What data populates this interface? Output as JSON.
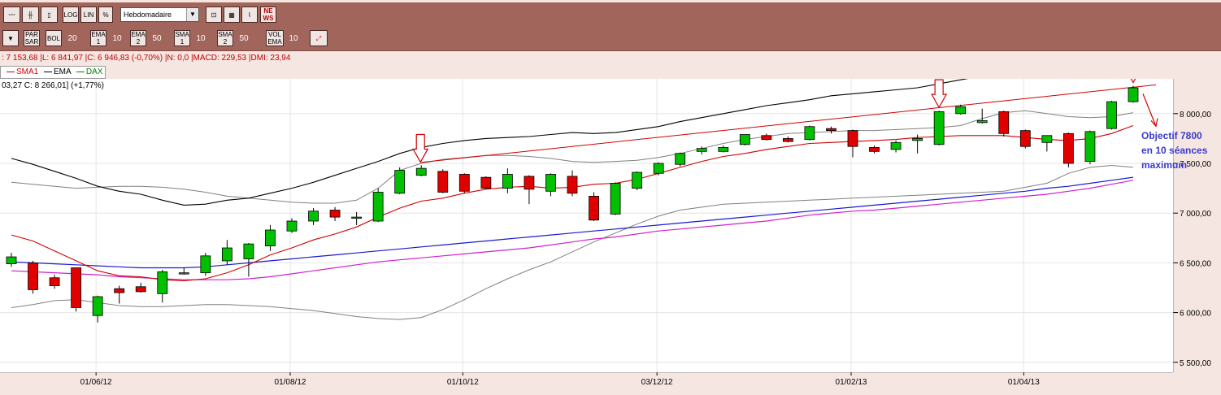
{
  "toolbar1": {
    "buttons": [
      "LOG",
      "LIN",
      "%"
    ],
    "period_select": "Hebdomadaire"
  },
  "toolbar2": {
    "items": [
      {
        "label": "PAR SAR",
        "value": ""
      },
      {
        "label": "BOL",
        "value": "20"
      },
      {
        "label": "EMA 1",
        "value": "10"
      },
      {
        "label": "EMA 2",
        "value": "50"
      },
      {
        "label": "SMA 1",
        "value": "10"
      },
      {
        "label": "SMA 2",
        "value": "50"
      },
      {
        "label": "VOL EMA",
        "value": "10"
      }
    ]
  },
  "status_line": ": 7 153,68 |L: 6 841,97 |C: 6 946,83 (-0,70%) |N: 0,0 |MACD: 229,53 |DMI: 23,94",
  "legend": [
    {
      "name": "SMA1",
      "color": "#d00000"
    },
    {
      "name": "EMA",
      "color": "#000000"
    },
    {
      "name": "DAX",
      "color": "#008000"
    }
  ],
  "price_label": "03,27  C: 8 266,01] (+1,77%)",
  "annotation": {
    "line1": "Objectif 7800",
    "line2": "en 10 séances",
    "line3": "maximum"
  },
  "chart_data": {
    "type": "candlestick",
    "x_tick_labels": [
      "01/06/12",
      "01/08/12",
      "01/10/12",
      "03/12/12",
      "01/02/13",
      "01/04/13"
    ],
    "y_tick_labels": [
      "5 500,00",
      "6 000,00",
      "6 500,00",
      "7 000,00",
      "7 500,00",
      "8 000,00"
    ],
    "ylim": [
      5400,
      8350
    ],
    "grid": true,
    "colors": {
      "up": "#00c000",
      "down": "#e00000",
      "sma1": "#d00000",
      "ema": "#000000",
      "blue": "#1a1ad0",
      "magenta": "#d020d0",
      "bollinger": "#808080"
    },
    "candles": [
      {
        "o": 6490,
        "c": 6560,
        "h": 6600,
        "l": 6460
      },
      {
        "o": 6500,
        "c": 6230,
        "h": 6520,
        "l": 6190
      },
      {
        "o": 6350,
        "c": 6270,
        "h": 6380,
        "l": 6240
      },
      {
        "o": 6450,
        "c": 6050,
        "h": 6450,
        "l": 6010
      },
      {
        "o": 5970,
        "c": 6160,
        "h": 6170,
        "l": 5900
      },
      {
        "o": 6240,
        "c": 6200,
        "h": 6270,
        "l": 6090
      },
      {
        "o": 6260,
        "c": 6210,
        "h": 6300,
        "l": 6200
      },
      {
        "o": 6190,
        "c": 6410,
        "h": 6430,
        "l": 6100
      },
      {
        "o": 6390,
        "c": 6400,
        "h": 6450,
        "l": 6380
      },
      {
        "o": 6400,
        "c": 6570,
        "h": 6600,
        "l": 6370
      },
      {
        "o": 6520,
        "c": 6650,
        "h": 6730,
        "l": 6480
      },
      {
        "o": 6540,
        "c": 6690,
        "h": 6700,
        "l": 6360
      },
      {
        "o": 6670,
        "c": 6830,
        "h": 6880,
        "l": 6620
      },
      {
        "o": 6820,
        "c": 6920,
        "h": 6950,
        "l": 6800
      },
      {
        "o": 6920,
        "c": 7020,
        "h": 7050,
        "l": 6880
      },
      {
        "o": 7030,
        "c": 6960,
        "h": 7060,
        "l": 6920
      },
      {
        "o": 6960,
        "c": 6960,
        "h": 7010,
        "l": 6880
      },
      {
        "o": 6920,
        "c": 7210,
        "h": 7250,
        "l": 6910
      },
      {
        "o": 7200,
        "c": 7430,
        "h": 7460,
        "l": 7190
      },
      {
        "o": 7380,
        "c": 7450,
        "h": 7480,
        "l": 7370
      },
      {
        "o": 7420,
        "c": 7210,
        "h": 7440,
        "l": 7200
      },
      {
        "o": 7390,
        "c": 7220,
        "h": 7400,
        "l": 7200
      },
      {
        "o": 7360,
        "c": 7250,
        "h": 7370,
        "l": 7240
      },
      {
        "o": 7250,
        "c": 7390,
        "h": 7450,
        "l": 7200
      },
      {
        "o": 7370,
        "c": 7240,
        "h": 7380,
        "l": 7090
      },
      {
        "o": 7220,
        "c": 7390,
        "h": 7400,
        "l": 7170
      },
      {
        "o": 7370,
        "c": 7200,
        "h": 7430,
        "l": 7170
      },
      {
        "o": 7170,
        "c": 6930,
        "h": 7210,
        "l": 6920
      },
      {
        "o": 6990,
        "c": 7300,
        "h": 7310,
        "l": 6980
      },
      {
        "o": 7250,
        "c": 7410,
        "h": 7420,
        "l": 7230
      },
      {
        "o": 7400,
        "c": 7500,
        "h": 7510,
        "l": 7380
      },
      {
        "o": 7490,
        "c": 7600,
        "h": 7610,
        "l": 7470
      },
      {
        "o": 7620,
        "c": 7650,
        "h": 7670,
        "l": 7590
      },
      {
        "o": 7620,
        "c": 7660,
        "h": 7680,
        "l": 7610
      },
      {
        "o": 7690,
        "c": 7790,
        "h": 7790,
        "l": 7680
      },
      {
        "o": 7780,
        "c": 7740,
        "h": 7800,
        "l": 7730
      },
      {
        "o": 7750,
        "c": 7720,
        "h": 7770,
        "l": 7710
      },
      {
        "o": 7740,
        "c": 7870,
        "h": 7880,
        "l": 7730
      },
      {
        "o": 7850,
        "c": 7830,
        "h": 7870,
        "l": 7800
      },
      {
        "o": 7830,
        "c": 7670,
        "h": 7840,
        "l": 7560
      },
      {
        "o": 7660,
        "c": 7620,
        "h": 7680,
        "l": 7600
      },
      {
        "o": 7640,
        "c": 7710,
        "h": 7730,
        "l": 7610
      },
      {
        "o": 7730,
        "c": 7750,
        "h": 7790,
        "l": 7600
      },
      {
        "o": 7690,
        "c": 8020,
        "h": 8030,
        "l": 7680
      },
      {
        "o": 8000,
        "c": 8070,
        "h": 8090,
        "l": 7990
      },
      {
        "o": 7910,
        "c": 7930,
        "h": 8050,
        "l": 7900
      },
      {
        "o": 8020,
        "c": 7800,
        "h": 8030,
        "l": 7770
      },
      {
        "o": 7830,
        "c": 7670,
        "h": 7840,
        "l": 7650
      },
      {
        "o": 7710,
        "c": 7780,
        "h": 7780,
        "l": 7620
      },
      {
        "o": 7800,
        "c": 7500,
        "h": 7810,
        "l": 7460
      },
      {
        "o": 7520,
        "c": 7820,
        "h": 7830,
        "l": 7490
      },
      {
        "o": 7850,
        "c": 8120,
        "h": 8130,
        "l": 7840
      },
      {
        "o": 8120,
        "c": 8260,
        "h": 8280,
        "l": 8110
      }
    ],
    "ema": [
      7550,
      7490,
      7420,
      7350,
      7270,
      7220,
      7190,
      7130,
      7080,
      7090,
      7130,
      7150,
      7200,
      7250,
      7310,
      7380,
      7450,
      7520,
      7600,
      7660,
      7700,
      7730,
      7750,
      7760,
      7770,
      7790,
      7810,
      7800,
      7810,
      7840,
      7870,
      7920,
      7960,
      8000,
      8040,
      8080,
      8110,
      8140,
      8180,
      8200,
      8220,
      8240,
      8260,
      8300,
      8340,
      8380,
      8400,
      8420,
      8440,
      8460,
      8480,
      8520,
      8580
    ],
    "sma1": [
      6780,
      6720,
      6620,
      6520,
      6420,
      6370,
      6360,
      6330,
      6320,
      6340,
      6400,
      6480,
      6580,
      6650,
      6730,
      6790,
      6860,
      6960,
      7050,
      7120,
      7150,
      7200,
      7240,
      7260,
      7270,
      7250,
      7260,
      7290,
      7300,
      7340,
      7400,
      7460,
      7520,
      7570,
      7600,
      7640,
      7670,
      7700,
      7710,
      7720,
      7730,
      7740,
      7760,
      7770,
      7780,
      7780,
      7780,
      7760,
      7740,
      7730,
      7750,
      7800,
      7880
    ],
    "blue_ma": [
      6510,
      6500,
      6490,
      6480,
      6470,
      6460,
      6450,
      6450,
      6450,
      6460,
      6480,
      6500,
      6520,
      6540,
      6560,
      6580,
      6600,
      6620,
      6640,
      6660,
      6680,
      6700,
      6720,
      6740,
      6760,
      6780,
      6800,
      6820,
      6840,
      6860,
      6880,
      6900,
      6920,
      6940,
      6960,
      6980,
      7000,
      7020,
      7040,
      7060,
      7080,
      7100,
      7120,
      7140,
      7160,
      7180,
      7200,
      7220,
      7250,
      7270,
      7300,
      7330,
      7360
    ],
    "magenta_ma": [
      6420,
      6410,
      6400,
      6390,
      6380,
      6360,
      6350,
      6340,
      6330,
      6330,
      6330,
      6340,
      6360,
      6390,
      6420,
      6450,
      6480,
      6510,
      6530,
      6550,
      6570,
      6590,
      6610,
      6630,
      6650,
      6680,
      6710,
      6740,
      6760,
      6790,
      6820,
      6840,
      6860,
      6880,
      6900,
      6920,
      6950,
      6980,
      7000,
      7020,
      7030,
      7050,
      7070,
      7090,
      7110,
      7130,
      7150,
      7170,
      7190,
      7220,
      7250,
      7290,
      7330
    ],
    "boll_upper": [
      7310,
      7290,
      7270,
      7250,
      7260,
      7270,
      7270,
      7260,
      7240,
      7210,
      7170,
      7150,
      7130,
      7110,
      7100,
      7100,
      7130,
      7250,
      7430,
      7500,
      7540,
      7560,
      7580,
      7580,
      7570,
      7550,
      7520,
      7510,
      7520,
      7530,
      7560,
      7600,
      7650,
      7700,
      7740,
      7770,
      7800,
      7810,
      7820,
      7830,
      7830,
      7840,
      7850,
      7860,
      7880,
      7950,
      8010,
      8030,
      8000,
      7970,
      7960,
      7970,
      8010
    ],
    "boll_lower": [
      6050,
      6080,
      6120,
      6130,
      6100,
      6070,
      6060,
      6060,
      6070,
      6080,
      6080,
      6070,
      6060,
      6040,
      6020,
      5990,
      5960,
      5940,
      5930,
      5950,
      6030,
      6130,
      6240,
      6340,
      6430,
      6510,
      6610,
      6710,
      6800,
      6890,
      6970,
      7030,
      7060,
      7090,
      7100,
      7110,
      7120,
      7130,
      7140,
      7150,
      7160,
      7170,
      7180,
      7190,
      7200,
      7210,
      7220,
      7260,
      7300,
      7400,
      7460,
      7480,
      7460
    ],
    "resistance_line": {
      "from": 7510,
      "to": 8290
    },
    "arrow_candles": [
      19,
      43,
      52
    ]
  }
}
